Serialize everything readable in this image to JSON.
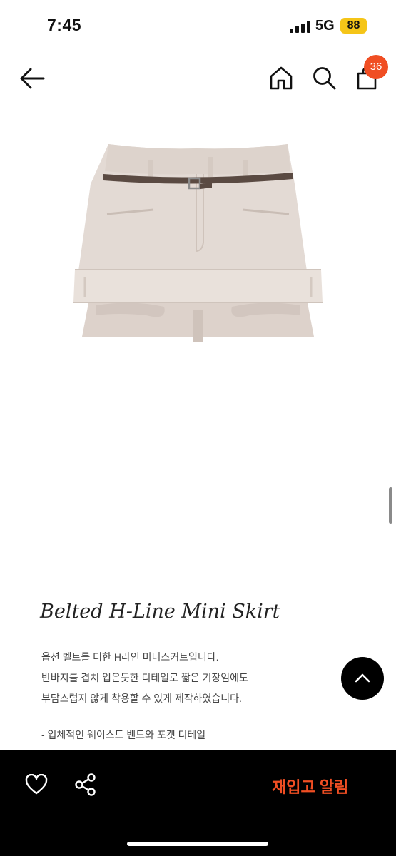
{
  "status_bar": {
    "time": "7:45",
    "network": "5G",
    "battery": "88",
    "battery_color": "#f5c518"
  },
  "nav": {
    "back_icon": "arrow-left-icon",
    "home_icon": "home-icon",
    "search_icon": "search-icon",
    "cart_icon": "shopping-bag-icon",
    "cart_count": "36",
    "badge_color": "#f04e23"
  },
  "product": {
    "image": "belted-mini-skirt-photo",
    "title": "Belted H-Line Mini Skirt",
    "description": [
      "옵션 벨트를 더한 H라인 미니스커트입니다.",
      "반바지를 겹쳐 입은듯한 디테일로 짧은 기장임에도",
      "부담스럽지 않게 착용할 수 있게 제작하였습니다."
    ],
    "details": [
      "- 입체적인 웨이스트 밴드와 포켓 디테일"
    ]
  },
  "scroll_top_icon": "chevron-up-icon",
  "bottom_bar": {
    "wishlist_icon": "heart-icon",
    "share_icon": "share-icon",
    "restock_label": "재입고 알림",
    "accent_color": "#f04e23"
  }
}
